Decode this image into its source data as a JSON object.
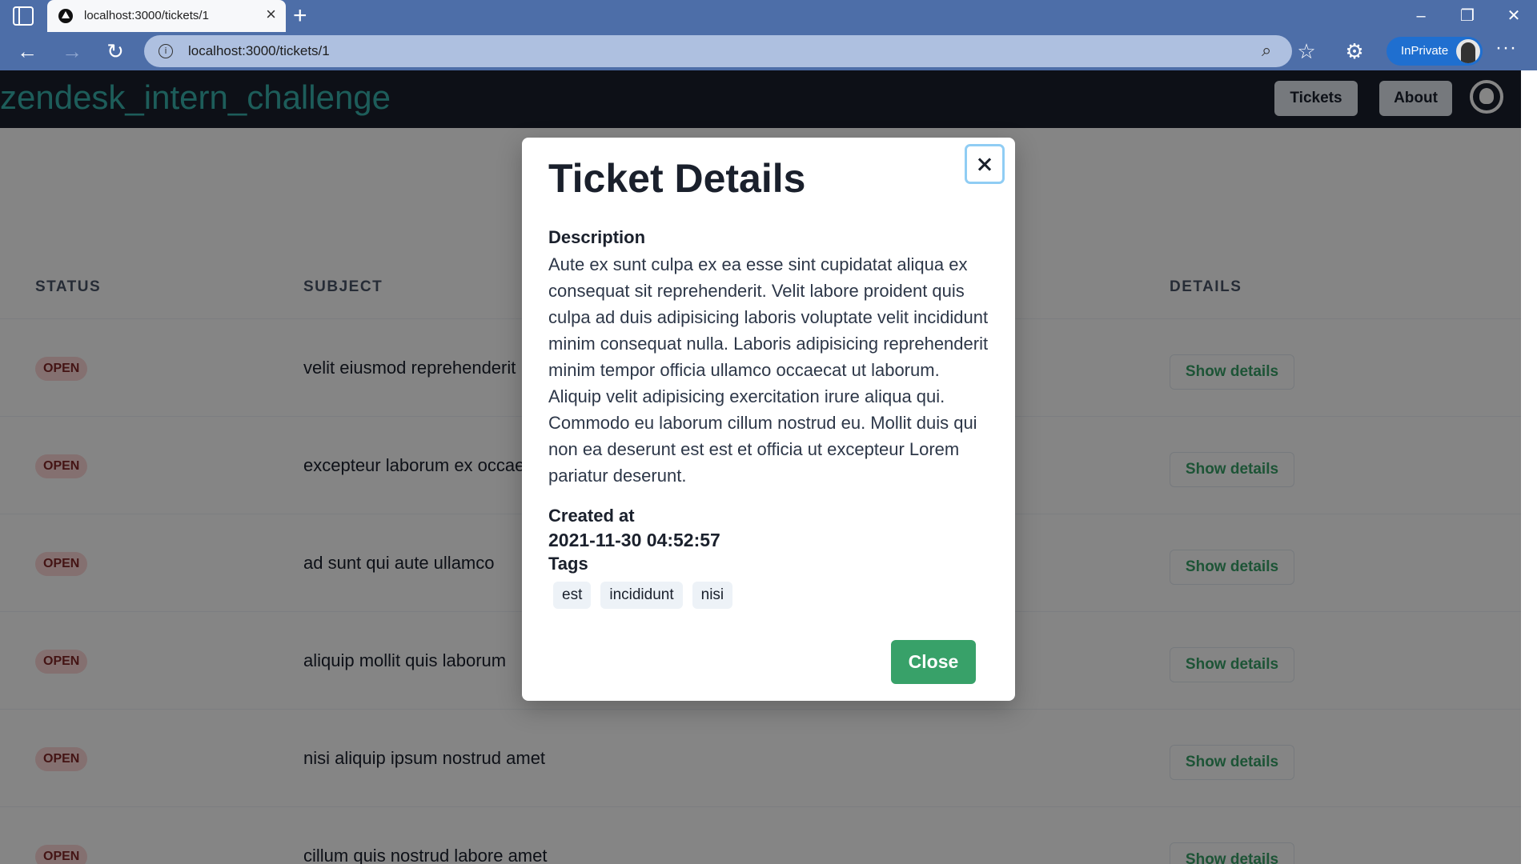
{
  "browser": {
    "tab_title": "localhost:3000/tickets/1",
    "new_tab": "+",
    "address": "localhost:3000/tickets/1",
    "inprivate_label": "InPrivate",
    "more": "···"
  },
  "app": {
    "brand": "zendesk_intern_challenge",
    "nav": {
      "tickets": "Tickets",
      "about": "About"
    }
  },
  "table": {
    "headers": {
      "status": "Status",
      "subject": "Subject",
      "details": "Details"
    },
    "rows": [
      {
        "status": "OPEN",
        "subject": "velit eiusmod reprehenderit",
        "action": "Show details"
      },
      {
        "status": "OPEN",
        "subject": "excepteur laborum ex occaecat",
        "action": "Show details"
      },
      {
        "status": "OPEN",
        "subject": "ad sunt qui aute ullamco",
        "action": "Show details"
      },
      {
        "status": "OPEN",
        "subject": "aliquip mollit quis laborum",
        "action": "Show details"
      },
      {
        "status": "OPEN",
        "subject": "nisi aliquip ipsum nostrud amet",
        "action": "Show details"
      },
      {
        "status": "OPEN",
        "subject": "cillum quis nostrud labore amet",
        "action": "Show details"
      }
    ]
  },
  "modal": {
    "title": "Ticket Details",
    "description_label": "Description",
    "description": "Aute ex sunt culpa ex ea esse sint cupidatat aliqua ex consequat sit reprehenderit. Velit labore proident quis culpa ad duis adipisicing laboris voluptate velit incididunt minim consequat nulla. Laboris adipisicing reprehenderit minim tempor officia ullamco occaecat ut laborum. Aliquip velit adipisicing exercitation irure aliqua qui. Commodo eu laborum cillum nostrud eu. Mollit duis qui non ea deserunt est est et officia ut excepteur Lorem pariatur deserunt.",
    "created_label": "Created at",
    "created_value": "2021-11-30 04:52:57",
    "tags_label": "Tags",
    "tags": [
      "est",
      "incididunt",
      "nisi"
    ],
    "close_label": "Close"
  },
  "colors": {
    "accent": "#38a169",
    "brand_teal": "#38b2ac",
    "header_bg": "#1a202c",
    "badge_bg": "#fed7d7",
    "chrome": "#4d6ea8"
  },
  "icons": {
    "sidebar": "sidebar-icon",
    "back": "back-arrow-icon",
    "forward": "forward-arrow-icon",
    "refresh": "refresh-icon",
    "info": "info-icon",
    "zoom": "zoom-icon",
    "favorites": "add-favorite-icon",
    "extensions": "extensions-icon",
    "github": "github-icon"
  }
}
